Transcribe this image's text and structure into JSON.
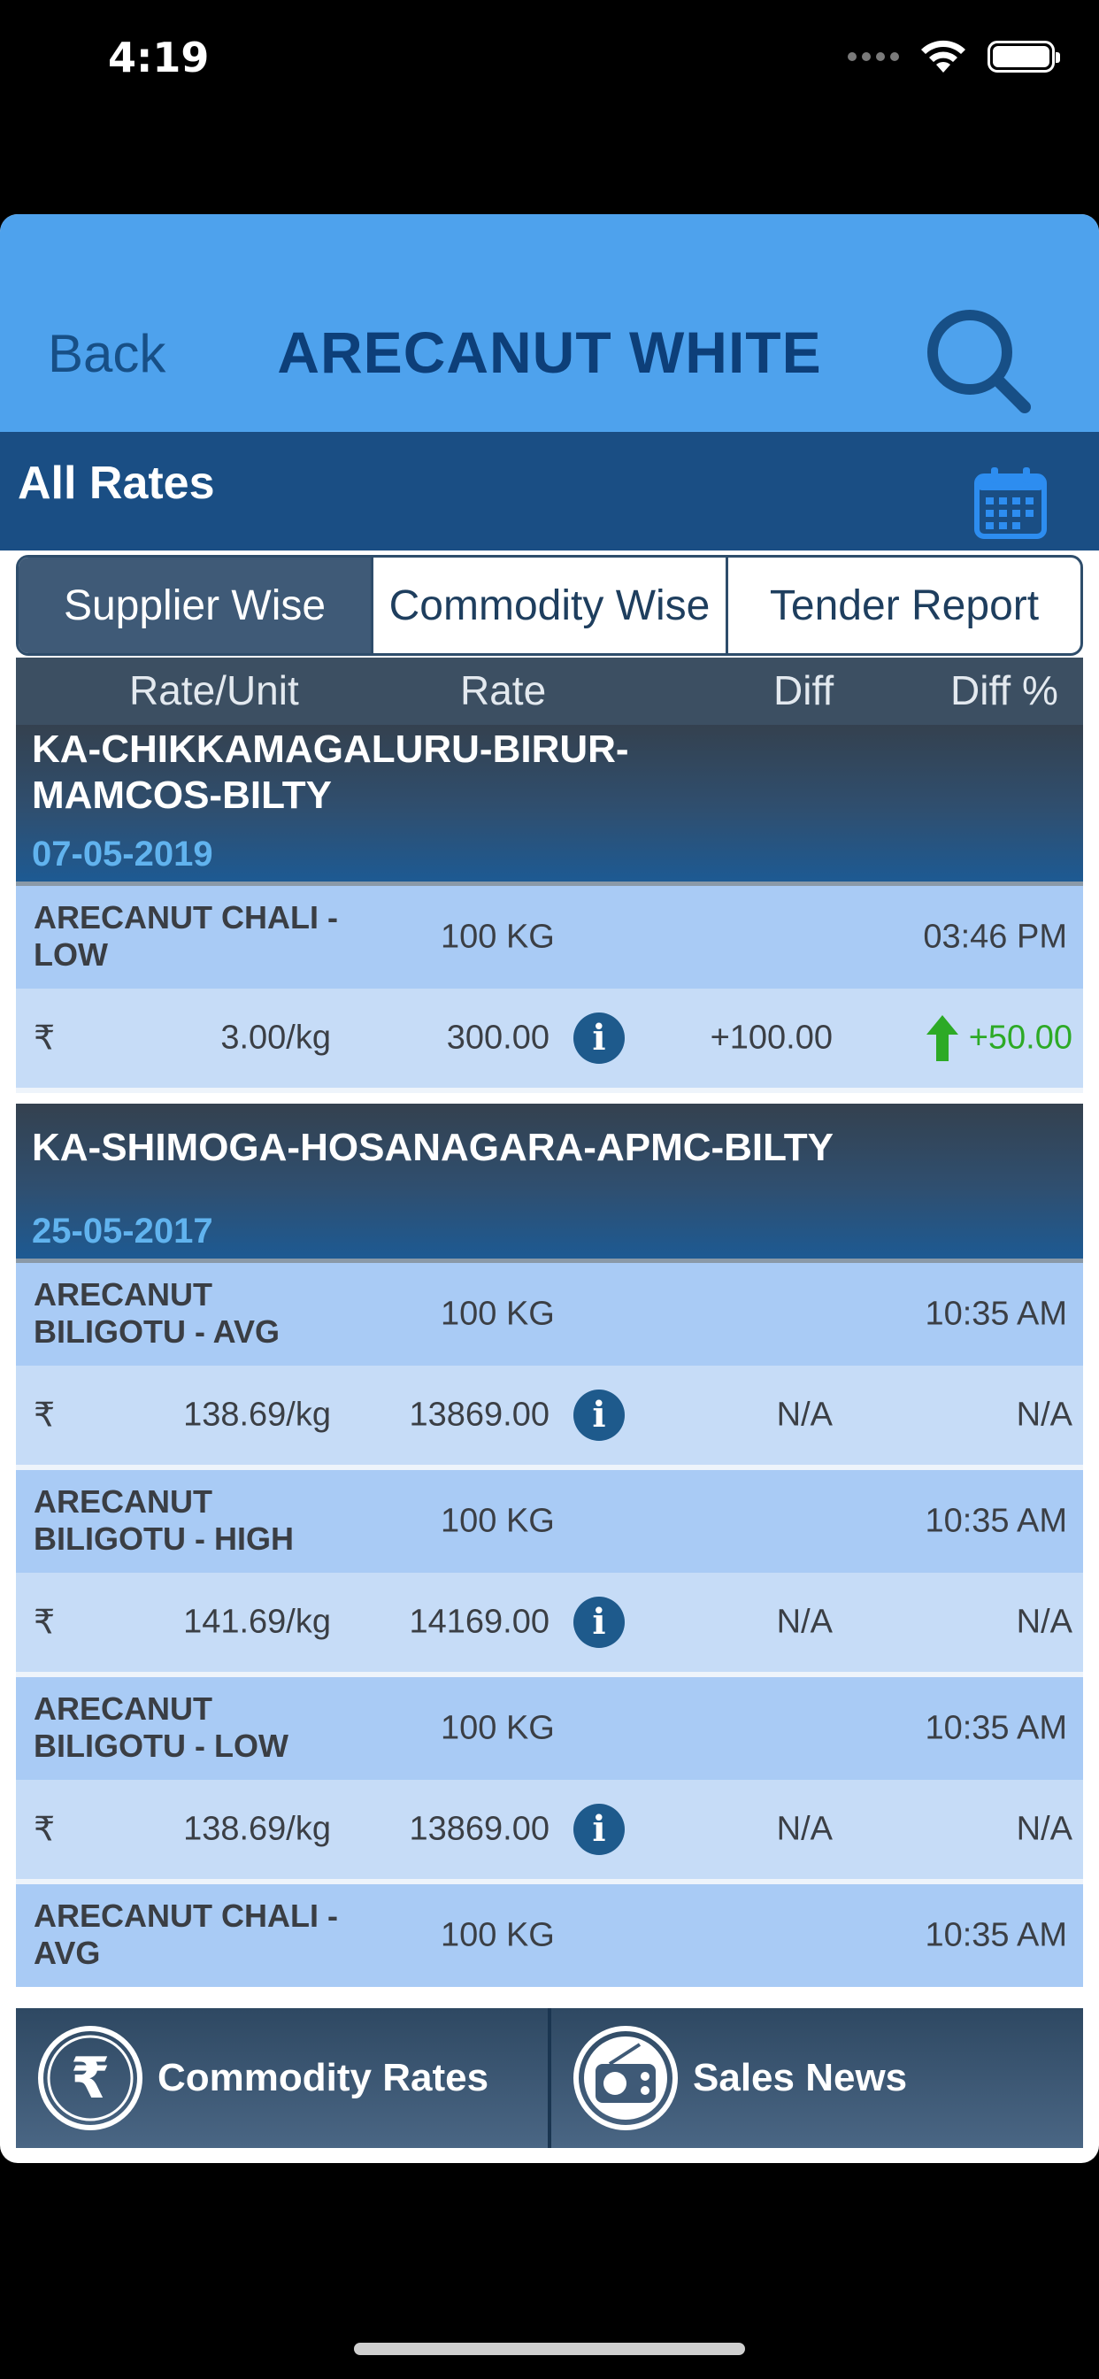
{
  "status_bar": {
    "time": "4:19"
  },
  "nav": {
    "back_label": "Back",
    "title": "ARECANUT WHITE",
    "search_icon": "search-icon"
  },
  "subbar": {
    "title": "All Rates",
    "calendar_icon": "calendar-icon"
  },
  "tabs": [
    {
      "label": "Supplier Wise",
      "active": true
    },
    {
      "label": "Commodity Wise",
      "active": false
    },
    {
      "label": "Tender Report",
      "active": false
    }
  ],
  "columns": {
    "rate_unit": "Rate/Unit",
    "rate": "Rate",
    "diff": "Diff",
    "diff_pct": "Diff %"
  },
  "currency_symbol": "₹",
  "groups": [
    {
      "name": "KA-CHIKKAMAGALURU-BIRUR-MAMCOS-BILTY",
      "date": "07-05-2019",
      "items": [
        {
          "name": "ARECANUT CHALI - LOW",
          "unit": "100 KG",
          "time": "03:46 PM",
          "rate_unit": "3.00/kg",
          "rate": "300.00",
          "diff": "+100.00",
          "diff_pct": "+50.00"
        }
      ]
    },
    {
      "name": "KA-SHIMOGA-HOSANAGARA-APMC-BILTY",
      "date": "25-05-2017",
      "items": [
        {
          "name": "ARECANUT BILIGOTU - AVG",
          "unit": "100 KG",
          "time": "10:35 AM",
          "rate_unit": "138.69/kg",
          "rate": "13869.00",
          "diff": "N/A",
          "diff_pct": "N/A"
        },
        {
          "name": "ARECANUT BILIGOTU - HIGH",
          "unit": "100 KG",
          "time": "10:35 AM",
          "rate_unit": "141.69/kg",
          "rate": "14169.00",
          "diff": "N/A",
          "diff_pct": "N/A"
        },
        {
          "name": "ARECANUT BILIGOTU - LOW",
          "unit": "100 KG",
          "time": "10:35 AM",
          "rate_unit": "138.69/kg",
          "rate": "13869.00",
          "diff": "N/A",
          "diff_pct": "N/A"
        },
        {
          "name": "ARECANUT CHALI - AVG",
          "unit": "100 KG",
          "time": "10:35 AM"
        }
      ]
    }
  ],
  "bottom_tabs": [
    {
      "label": "Commodity Rates",
      "icon": "rupee-icon"
    },
    {
      "label": "Sales News",
      "icon": "radio-icon"
    }
  ],
  "colors": {
    "nav_bg": "#4ea2ed",
    "subbar_bg": "#1a4e84",
    "title": "#0d3f79",
    "up": "#2daa26"
  }
}
